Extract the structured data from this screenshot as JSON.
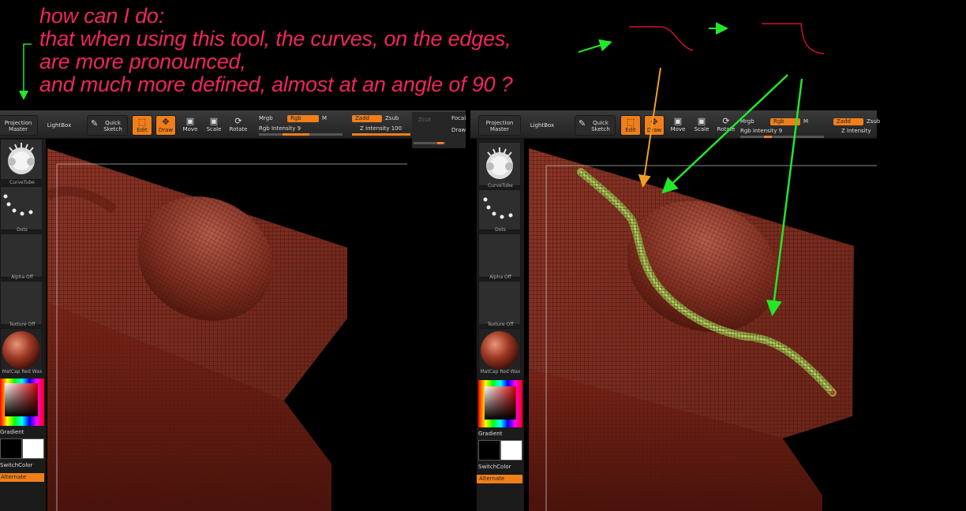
{
  "annotation": {
    "lines": [
      "how can I do:",
      "that when using this tool, the curves, on the edges,",
      "are more pronounced,",
      "and much more defined, almost at an angle of 90 ?"
    ]
  },
  "colors": {
    "annotation_text": "#f0265a",
    "arrow_green": "#22e82a",
    "arrow_orange": "#f0a020",
    "ui_accent": "#f07f1a",
    "mesh": "#7a2a1f"
  },
  "toolbar": {
    "projection_master": "Projection Master",
    "lightbox": "LightBox",
    "quick_sketch": "Quick Sketch",
    "edit": "Edit",
    "draw": "Draw",
    "move": "Move",
    "scale": "Scale",
    "rotate": "Rotate",
    "mrgb": "Mrgb",
    "rgb": "Rgb",
    "m": "M",
    "rgb_intensity": "Rgb Intensity 9",
    "zadd": "Zadd",
    "zsub": "Zsub",
    "z_intensity": "Z Intensity 100",
    "z_intensity_right": "Z Intensity",
    "zcut": "Zcut",
    "focal": "Focal",
    "draw_size": "Draw"
  },
  "shelf": {
    "brush": "CurveTube",
    "stroke": "Dots",
    "alpha": "Alpha Off",
    "texture": "Texture Off",
    "material": "MatCap Red Wax",
    "gradient": "Gradient",
    "switch_color": "SwitchColor",
    "alternate": "Alternate"
  },
  "icons": {
    "edit": "edit-icon",
    "draw": "draw-icon",
    "move": "move-icon",
    "scale": "scale-icon",
    "rotate": "rotate-icon",
    "quick_sketch": "quick-sketch-icon"
  }
}
